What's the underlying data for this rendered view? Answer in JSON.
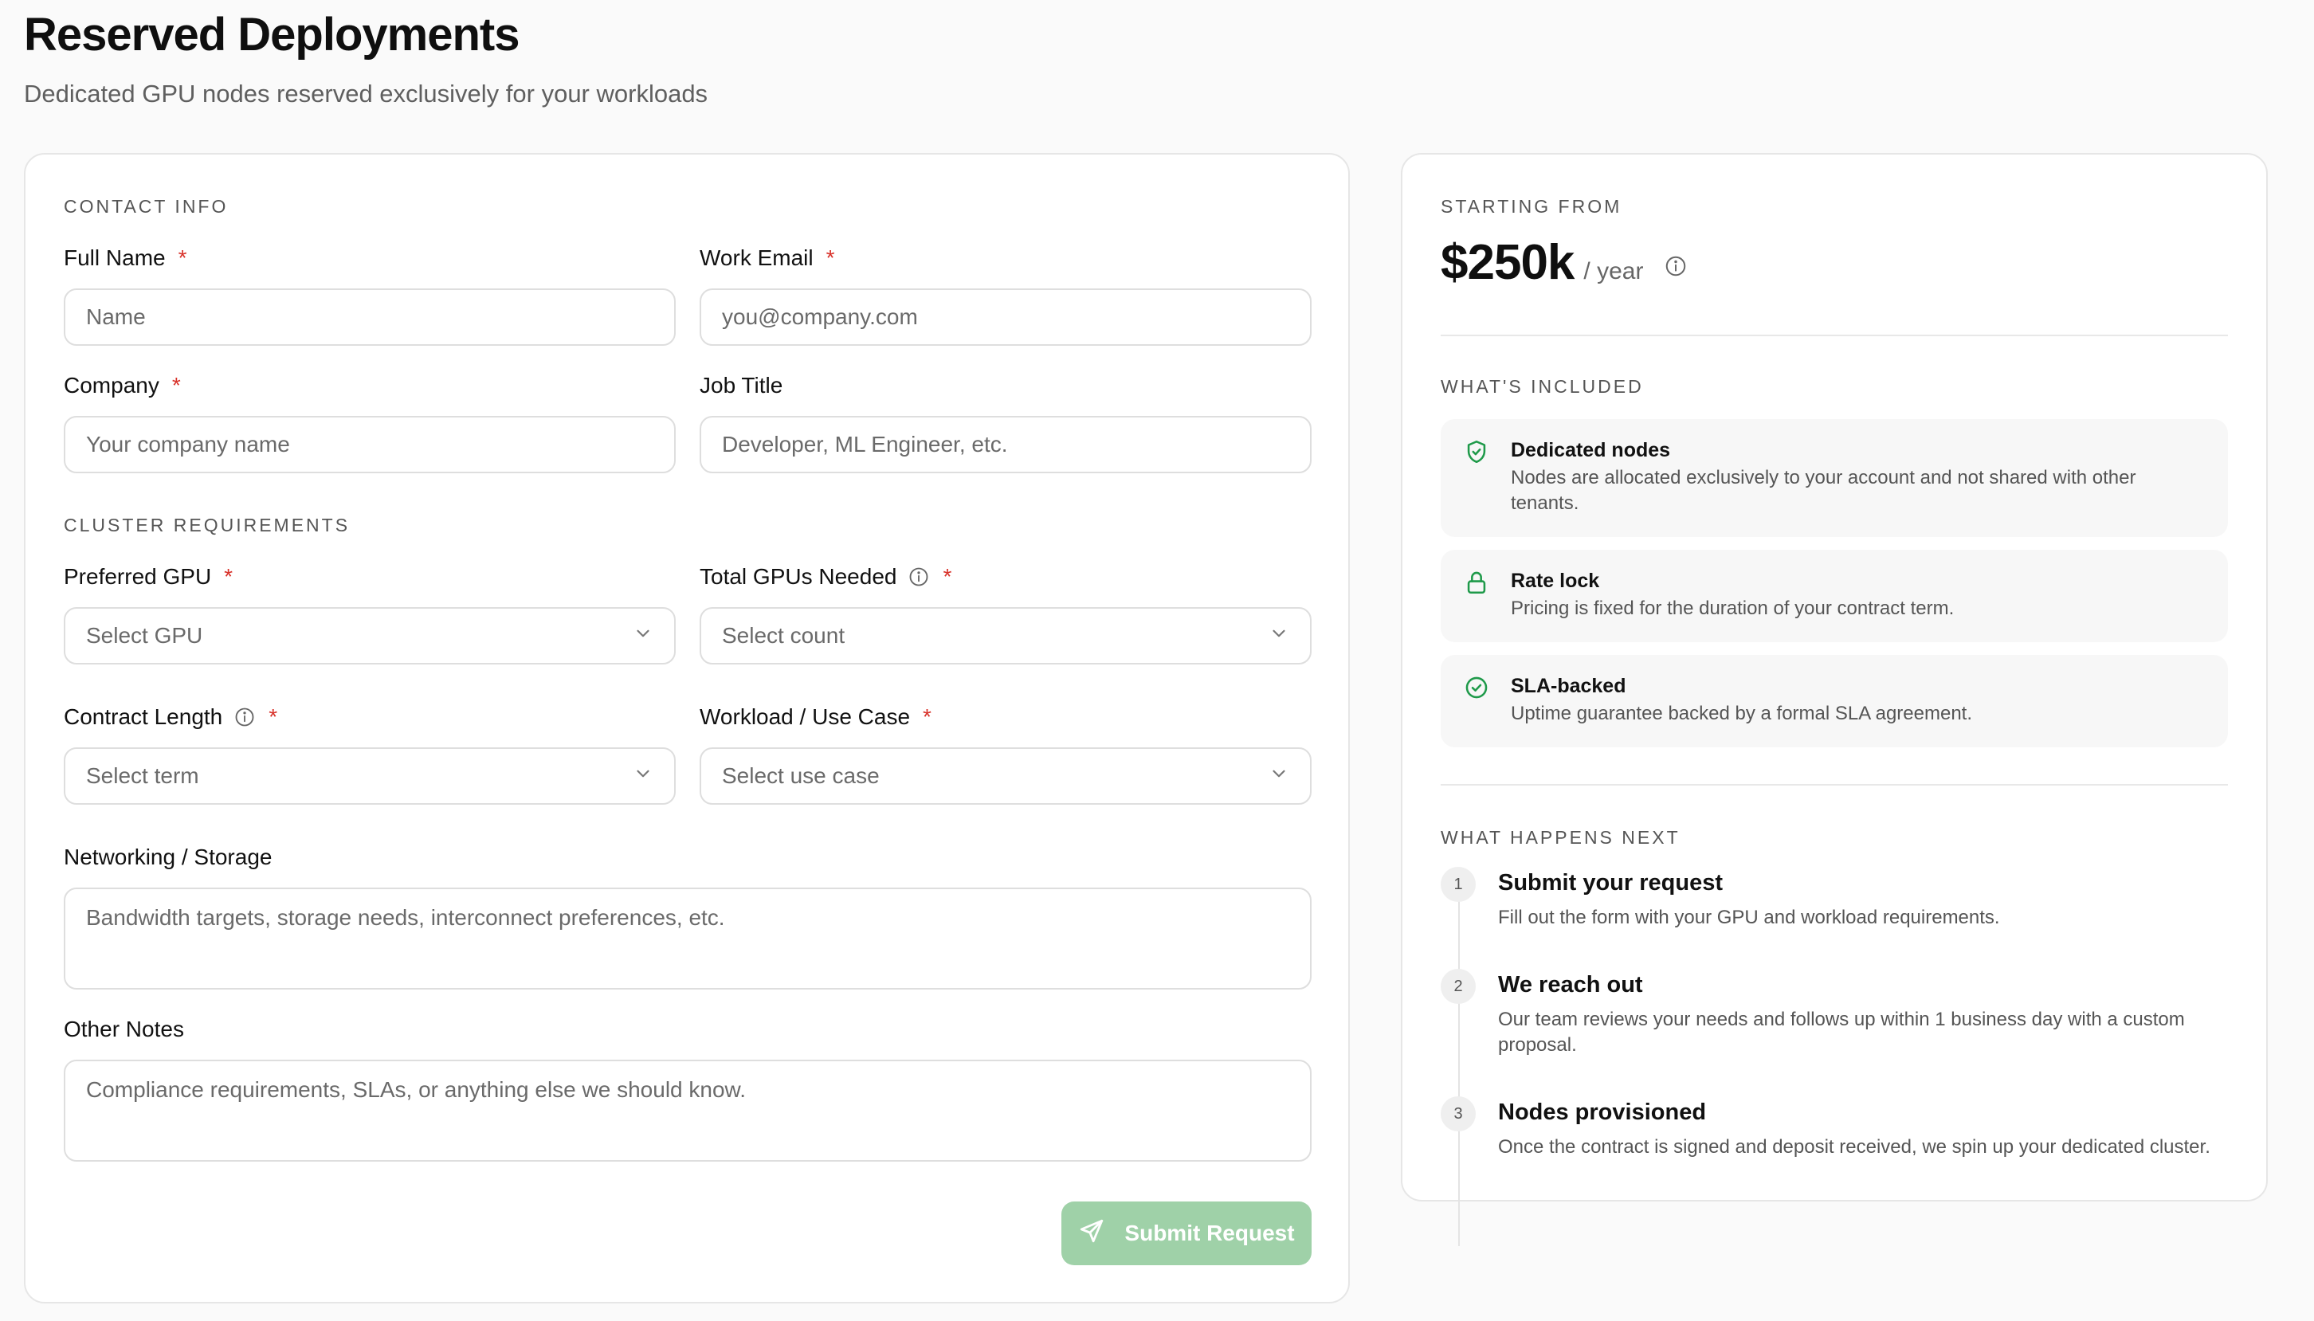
{
  "header": {
    "title": "Reserved Deployments",
    "subtitle": "Dedicated GPU nodes reserved exclusively for your workloads"
  },
  "form": {
    "sections": {
      "contact": "CONTACT INFO",
      "cluster": "CLUSTER REQUIREMENTS"
    },
    "required_mark": "*",
    "fields": {
      "full_name": {
        "label": "Full Name",
        "placeholder": "Name"
      },
      "work_email": {
        "label": "Work Email",
        "placeholder": "you@company.com"
      },
      "company": {
        "label": "Company",
        "placeholder": "Your company name"
      },
      "job_title": {
        "label": "Job Title",
        "placeholder": "Developer, ML Engineer, etc."
      },
      "preferred_gpu": {
        "label": "Preferred GPU",
        "placeholder": "Select GPU"
      },
      "total_gpus": {
        "label": "Total GPUs Needed",
        "placeholder": "Select count"
      },
      "contract_length": {
        "label": "Contract Length",
        "placeholder": "Select term"
      },
      "workload": {
        "label": "Workload / Use Case",
        "placeholder": "Select use case"
      },
      "networking": {
        "label": "Networking / Storage",
        "placeholder": "Bandwidth targets, storage needs, interconnect preferences, etc."
      },
      "other_notes": {
        "label": "Other Notes",
        "placeholder": "Compliance requirements, SLAs, or anything else we should know."
      }
    },
    "submit_label": "Submit Request"
  },
  "pricing": {
    "starting_label": "STARTING FROM",
    "price": "$250k",
    "period": "/ year",
    "included_label": "WHAT'S INCLUDED",
    "features": [
      {
        "icon": "shield-check-icon",
        "title": "Dedicated nodes",
        "desc": "Nodes are allocated exclusively to your account and not shared with other tenants."
      },
      {
        "icon": "lock-icon",
        "title": "Rate lock",
        "desc": "Pricing is fixed for the duration of your contract term."
      },
      {
        "icon": "check-circle-icon",
        "title": "SLA-backed",
        "desc": "Uptime guarantee backed by a formal SLA agreement."
      }
    ],
    "next_label": "WHAT HAPPENS NEXT",
    "steps": [
      {
        "num": "1",
        "title": "Submit your request",
        "desc": "Fill out the form with your GPU and workload requirements."
      },
      {
        "num": "2",
        "title": "We reach out",
        "desc": "Our team reviews your needs and follows up within 1 business day with a custom proposal."
      },
      {
        "num": "3",
        "title": "Nodes provisioned",
        "desc": "Once the contract is signed and deposit received, we spin up your dedicated cluster."
      }
    ]
  },
  "colors": {
    "accent_green": "#1f9a4a",
    "button_green": "#9fd1a8",
    "required_red": "#d8322a"
  }
}
